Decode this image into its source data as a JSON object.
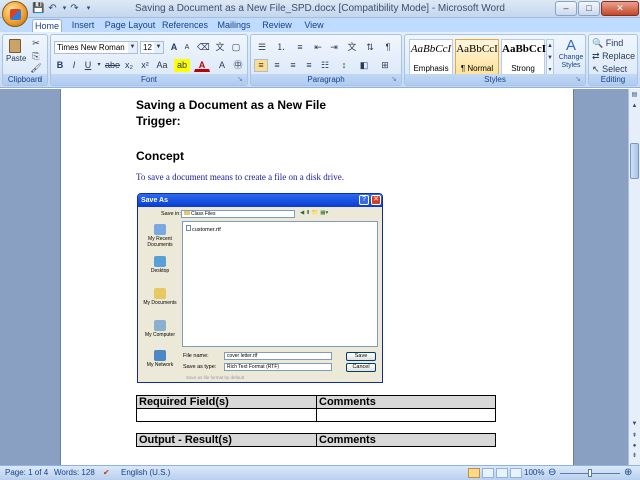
{
  "window": {
    "title": "Saving a Document as a New File_SPD.docx [Compatibility Mode] - Microsoft Word",
    "controls": {
      "minimize": "–",
      "maximize": "□",
      "close": "✕"
    }
  },
  "tabs": [
    "Home",
    "Insert",
    "Page Layout",
    "References",
    "Mailings",
    "Review",
    "View"
  ],
  "ribbon": {
    "clipboard": {
      "label": "Clipboard",
      "paste": "Paste"
    },
    "font": {
      "label": "Font",
      "family": "Times New Roman",
      "size": "12",
      "bold": "B",
      "italic": "I",
      "underline": "U",
      "strike": "abe",
      "subscript": "x₂",
      "superscript": "x²",
      "change_case": "Aa",
      "grow": "A",
      "shrink": "A"
    },
    "paragraph": {
      "label": "Paragraph"
    },
    "styles": {
      "label": "Styles",
      "items": [
        {
          "sample": "AaBbCcI",
          "name": "Emphasis"
        },
        {
          "sample": "AaBbCcI",
          "name": "¶ Normal"
        },
        {
          "sample": "AaBbCcI",
          "name": "Strong"
        }
      ],
      "change_styles": "Change Styles"
    },
    "editing": {
      "label": "Editing",
      "find": "Find",
      "replace": "Replace",
      "select": "Select"
    }
  },
  "document": {
    "heading1": "Saving a Document as a New File",
    "heading2": "Trigger:",
    "concept_heading": "Concept",
    "concept_text": "To save a document means to create a file on a disk drive.",
    "dialog": {
      "title": "Save As",
      "save_in_label": "Save in:",
      "save_in_value": "Class Files",
      "file_item": "customer.rtf",
      "places": [
        "My Recent Documents",
        "Desktop",
        "My Documents",
        "My Computer",
        "My Network"
      ],
      "file_name_label": "File name:",
      "file_name_value": "cover letter.rtf",
      "save_type_label": "Save as type:",
      "save_type_value": "Rich Text Format (RTF)",
      "save_button": "Save",
      "cancel_button": "Cancel",
      "footer_note": "Save as file format by default"
    },
    "table1": {
      "col1": "Required Field(s)",
      "col2": "Comments"
    },
    "table2": {
      "col1": "Output - Result(s)",
      "col2": "Comments"
    }
  },
  "status": {
    "page": "Page: 1 of 4",
    "words": "Words: 128",
    "language": "English (U.S.)",
    "zoom": "100%"
  },
  "colors": {
    "ribbon_bg": "#d3e3f7",
    "workspace": "#8aa0c2",
    "accent": "#15428b"
  }
}
